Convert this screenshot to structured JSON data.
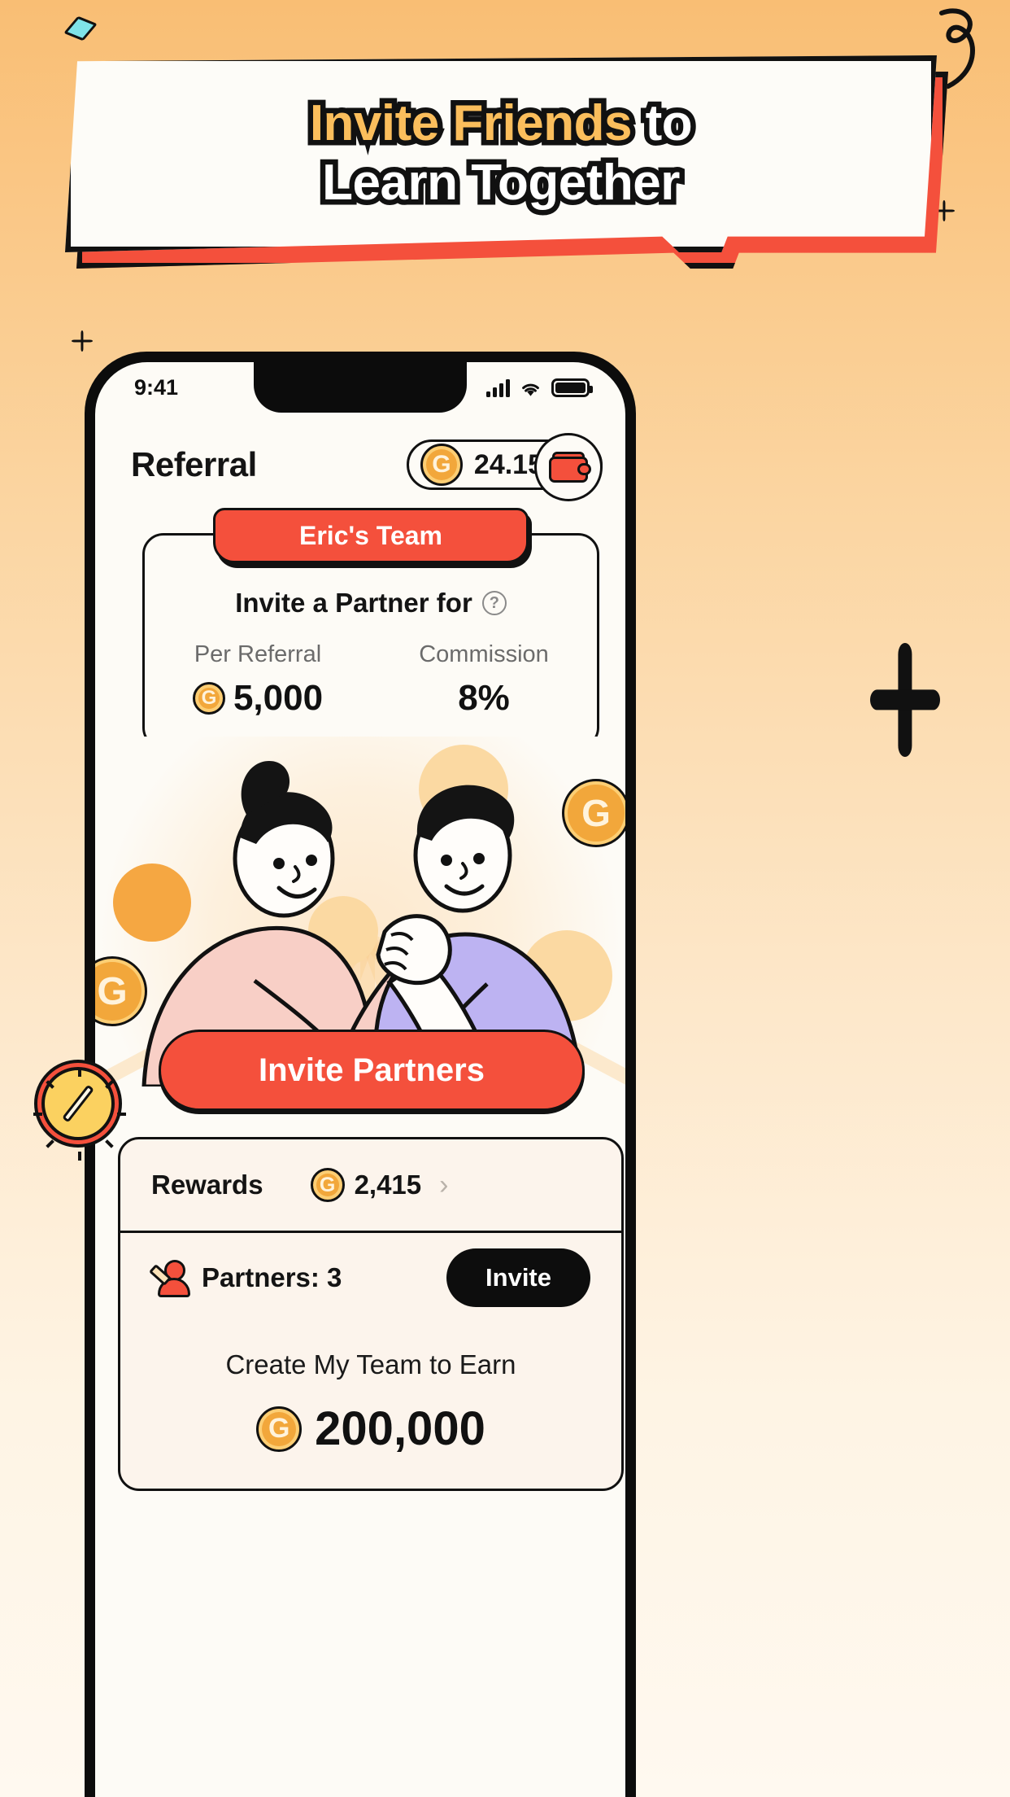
{
  "banner": {
    "line1_highlight": "Invite Friends",
    "line1_rest": " to",
    "line2": "Learn Together",
    "highlight_color": "#FBBE5C",
    "plain_color": "#FFFFFF"
  },
  "phone": {
    "status": {
      "time": "9:41",
      "signal_icon": "cellular-bars-icon",
      "wifi_icon": "wifi-icon",
      "battery_icon": "battery-full-icon"
    },
    "header": {
      "title": "Referral",
      "balance": "24.15",
      "coin_symbol": "G",
      "wallet_icon": "wallet-icon"
    },
    "team_card": {
      "tab_label": "Eric's Team",
      "subtitle": "Invite a Partner for",
      "help_icon": "question-mark-icon",
      "stats": [
        {
          "label": "Per Referral",
          "value": "5,000",
          "has_coin": true
        },
        {
          "label": "Commission",
          "value": "8%",
          "has_coin": false
        }
      ]
    },
    "cta_label": "Invite Partners",
    "list": {
      "rewards": {
        "label": "Rewards",
        "value": "2,415",
        "chevron_icon": "chevron-right-icon"
      },
      "partners": {
        "icon": "partner-person-icon",
        "label": "Partners: 3",
        "button_label": "Invite"
      },
      "earn": {
        "title": "Create My Team to Earn",
        "value": "200,000"
      }
    }
  },
  "decor": {
    "sparkle_cyan": "cyan-diamond-sparkle-icon",
    "sparkle_star_a": "four-point-star-icon",
    "sparkle_star_b": "four-point-star-icon",
    "big_sparkle": "large-four-point-star-icon",
    "compass": "compass-icon",
    "coins": "floating-coin-icon"
  },
  "colors": {
    "brand_red": "#F4503C",
    "coin_gold": "#F2A73B",
    "bg_top": "#F9BE74",
    "bg_bottom": "#FFF9F0",
    "ink": "#111111"
  }
}
